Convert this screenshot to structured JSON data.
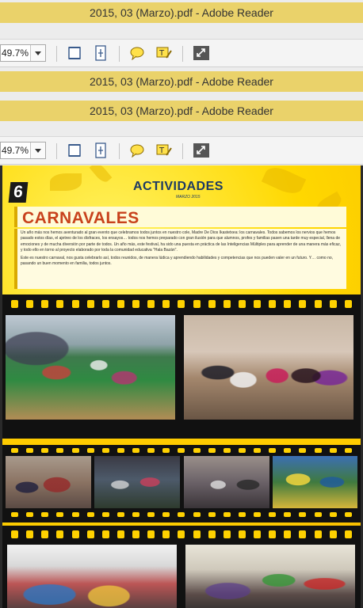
{
  "window": {
    "title": "2015, 03 (Marzo).pdf - Adobe Reader"
  },
  "toolbar": {
    "zoom_value": "49.7%",
    "icons": [
      "fit-page-icon",
      "fit-width-icon",
      "comment-icon",
      "highlight-icon",
      "fullscreen-icon"
    ]
  },
  "document": {
    "page_number": "6",
    "section_title": "ACTIVIDADES",
    "section_date": "MARZO 2015",
    "article_title": "CARNAVALES",
    "paragraph1": "Un año más nos hemos aventurado al gran evento que celebramos todos juntos en nuestro cole, Madre De Dios Ikastetxea: los carnavales. Todos sabemos los nervios que hemos pasado estos días, el ajetreo de los disfraces, los ensayos… todos nos hemos preparado con gran ilusión para que alumnos, profes y familias pasen una tarde muy especial, llena de emociones y de mucha diversión por parte de todos. Un año más, este festival, ha sido una puesta en práctica de las Inteligencias Múltiples para aprender de una manera más eficaz, y todo ello en torno al proyecto elaborado por toda la comunidad educativa \"Hala Bazán\".",
    "paragraph2": "Este es nuestro carnaval, nos gusta celebrarlo así, todos reunidos, de manera lúdica y aprendiendo habilidades y competencias que nos pueden valer en un futuro. Y… como no, pasando un buen momento en familia, todos juntos."
  },
  "colors": {
    "titlebar": "#ead26a",
    "page_yellow": "#ffd800",
    "film": "#111111",
    "heading_blue": "#1d3a63",
    "heading_red": "#c8421c"
  }
}
